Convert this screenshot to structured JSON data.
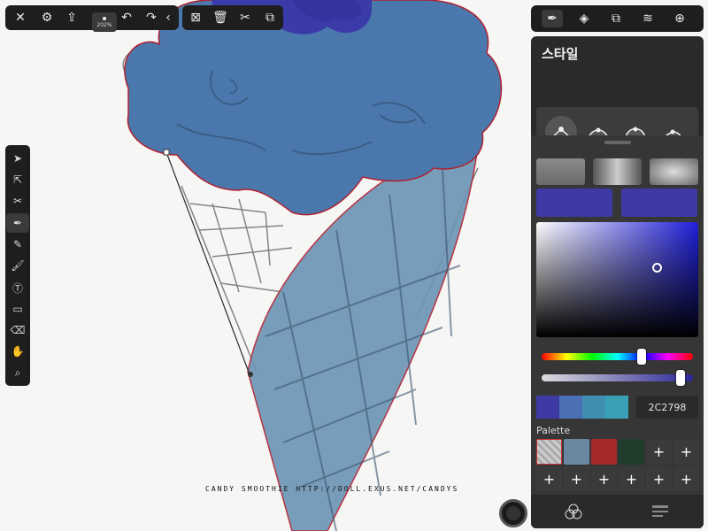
{
  "top_toolbar": {
    "icons": [
      "close-icon",
      "settings-icon",
      "share-icon",
      "undo-icon",
      "redo-icon",
      "collapse-icon"
    ],
    "zoom_label": "202%"
  },
  "edit_toolbar": {
    "icons": [
      "deselect-icon",
      "delete-icon",
      "cut-icon",
      "copy-icon"
    ]
  },
  "left_tools": [
    "select-icon",
    "node-select-icon",
    "scissors-icon",
    "pen-icon",
    "pencil-icon",
    "brush-icon",
    "text-icon",
    "rectangle-icon",
    "eraser-icon",
    "hand-icon",
    "zoom-icon"
  ],
  "panel": {
    "title": "스타일",
    "tabs": [
      "pen-style-tab",
      "shape-tab",
      "layers-copy-tab",
      "layers-tab",
      "add-tab"
    ],
    "hex_value": "2C2798",
    "palette_label": "Palette",
    "colors": {
      "current": "#2c2798",
      "picker_hue": "#1f1fd8",
      "palette": [
        "#c0c0c0",
        "#6b86a0",
        "#a52a2a",
        "#1f3d2a"
      ]
    },
    "hue_fraction": 0.66,
    "alpha_fraction": 0.92
  },
  "watermark": "CANDY SMOOTHIE HTTP://DOLL.EXUS.NET/CANDYS"
}
